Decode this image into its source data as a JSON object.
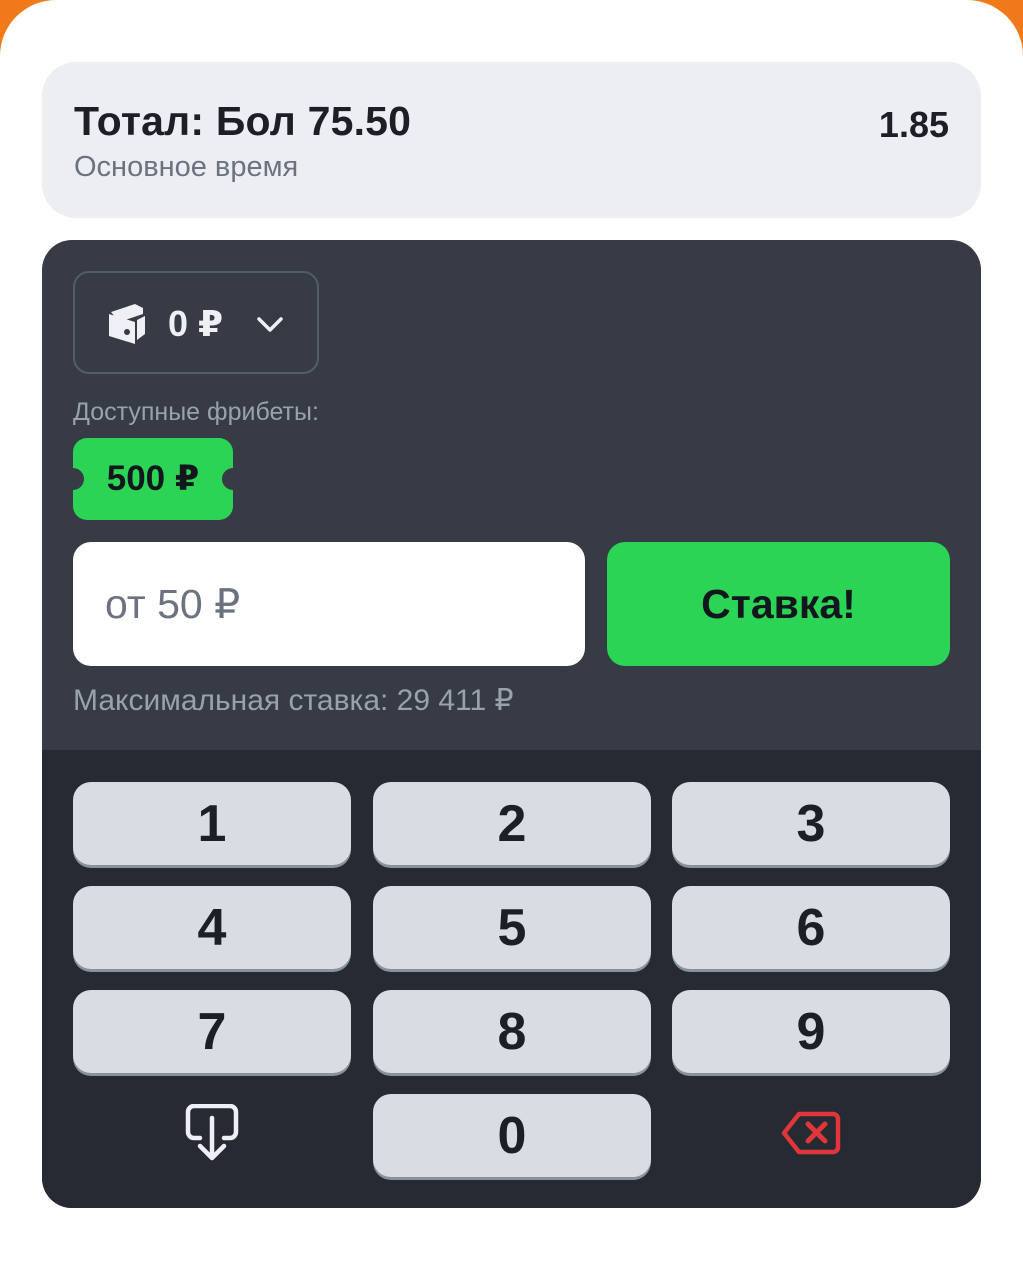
{
  "bet": {
    "title": "Тотал: Бол 75.50",
    "subtitle": "Основное время",
    "odds": "1.85"
  },
  "balance": {
    "value": "0 ₽",
    "icon": "wallet-icon",
    "dropdown_icon": "chevron-down-icon"
  },
  "freebets": {
    "label": "Доступные фрибеты:",
    "items": [
      "500 ₽"
    ]
  },
  "stake": {
    "placeholder": "от 50 ₽",
    "value": "",
    "submit_label": "Ставка!",
    "max_label": "Максимальная ставка: 29 411 ₽"
  },
  "keypad": {
    "keys": [
      "1",
      "2",
      "3",
      "4",
      "5",
      "6",
      "7",
      "8",
      "9",
      "0"
    ],
    "hide_icon": "keyboard-hide-icon",
    "backspace_icon": "backspace-icon"
  },
  "colors": {
    "accent_green": "#2bd455",
    "panel_dark": "#363b46",
    "keypad_dark": "#262a32",
    "backspace_red": "#e0353a",
    "header_orange": "#f07a1a"
  }
}
